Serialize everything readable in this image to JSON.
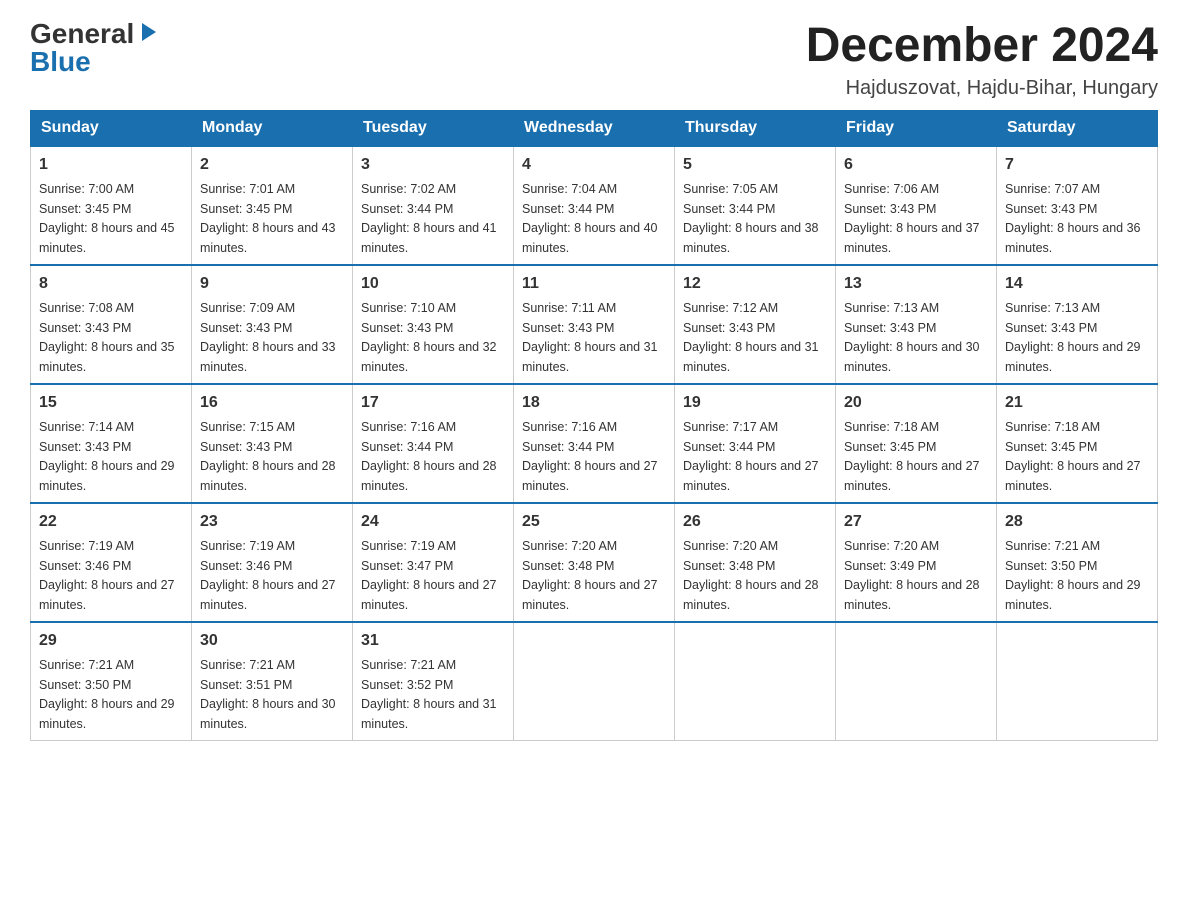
{
  "header": {
    "logo_general": "General",
    "logo_blue": "Blue",
    "month_title": "December 2024",
    "location": "Hajduszovat, Hajdu-Bihar, Hungary"
  },
  "columns": [
    "Sunday",
    "Monday",
    "Tuesday",
    "Wednesday",
    "Thursday",
    "Friday",
    "Saturday"
  ],
  "weeks": [
    [
      {
        "day": "1",
        "sunrise": "Sunrise: 7:00 AM",
        "sunset": "Sunset: 3:45 PM",
        "daylight": "Daylight: 8 hours and 45 minutes."
      },
      {
        "day": "2",
        "sunrise": "Sunrise: 7:01 AM",
        "sunset": "Sunset: 3:45 PM",
        "daylight": "Daylight: 8 hours and 43 minutes."
      },
      {
        "day": "3",
        "sunrise": "Sunrise: 7:02 AM",
        "sunset": "Sunset: 3:44 PM",
        "daylight": "Daylight: 8 hours and 41 minutes."
      },
      {
        "day": "4",
        "sunrise": "Sunrise: 7:04 AM",
        "sunset": "Sunset: 3:44 PM",
        "daylight": "Daylight: 8 hours and 40 minutes."
      },
      {
        "day": "5",
        "sunrise": "Sunrise: 7:05 AM",
        "sunset": "Sunset: 3:44 PM",
        "daylight": "Daylight: 8 hours and 38 minutes."
      },
      {
        "day": "6",
        "sunrise": "Sunrise: 7:06 AM",
        "sunset": "Sunset: 3:43 PM",
        "daylight": "Daylight: 8 hours and 37 minutes."
      },
      {
        "day": "7",
        "sunrise": "Sunrise: 7:07 AM",
        "sunset": "Sunset: 3:43 PM",
        "daylight": "Daylight: 8 hours and 36 minutes."
      }
    ],
    [
      {
        "day": "8",
        "sunrise": "Sunrise: 7:08 AM",
        "sunset": "Sunset: 3:43 PM",
        "daylight": "Daylight: 8 hours and 35 minutes."
      },
      {
        "day": "9",
        "sunrise": "Sunrise: 7:09 AM",
        "sunset": "Sunset: 3:43 PM",
        "daylight": "Daylight: 8 hours and 33 minutes."
      },
      {
        "day": "10",
        "sunrise": "Sunrise: 7:10 AM",
        "sunset": "Sunset: 3:43 PM",
        "daylight": "Daylight: 8 hours and 32 minutes."
      },
      {
        "day": "11",
        "sunrise": "Sunrise: 7:11 AM",
        "sunset": "Sunset: 3:43 PM",
        "daylight": "Daylight: 8 hours and 31 minutes."
      },
      {
        "day": "12",
        "sunrise": "Sunrise: 7:12 AM",
        "sunset": "Sunset: 3:43 PM",
        "daylight": "Daylight: 8 hours and 31 minutes."
      },
      {
        "day": "13",
        "sunrise": "Sunrise: 7:13 AM",
        "sunset": "Sunset: 3:43 PM",
        "daylight": "Daylight: 8 hours and 30 minutes."
      },
      {
        "day": "14",
        "sunrise": "Sunrise: 7:13 AM",
        "sunset": "Sunset: 3:43 PM",
        "daylight": "Daylight: 8 hours and 29 minutes."
      }
    ],
    [
      {
        "day": "15",
        "sunrise": "Sunrise: 7:14 AM",
        "sunset": "Sunset: 3:43 PM",
        "daylight": "Daylight: 8 hours and 29 minutes."
      },
      {
        "day": "16",
        "sunrise": "Sunrise: 7:15 AM",
        "sunset": "Sunset: 3:43 PM",
        "daylight": "Daylight: 8 hours and 28 minutes."
      },
      {
        "day": "17",
        "sunrise": "Sunrise: 7:16 AM",
        "sunset": "Sunset: 3:44 PM",
        "daylight": "Daylight: 8 hours and 28 minutes."
      },
      {
        "day": "18",
        "sunrise": "Sunrise: 7:16 AM",
        "sunset": "Sunset: 3:44 PM",
        "daylight": "Daylight: 8 hours and 27 minutes."
      },
      {
        "day": "19",
        "sunrise": "Sunrise: 7:17 AM",
        "sunset": "Sunset: 3:44 PM",
        "daylight": "Daylight: 8 hours and 27 minutes."
      },
      {
        "day": "20",
        "sunrise": "Sunrise: 7:18 AM",
        "sunset": "Sunset: 3:45 PM",
        "daylight": "Daylight: 8 hours and 27 minutes."
      },
      {
        "day": "21",
        "sunrise": "Sunrise: 7:18 AM",
        "sunset": "Sunset: 3:45 PM",
        "daylight": "Daylight: 8 hours and 27 minutes."
      }
    ],
    [
      {
        "day": "22",
        "sunrise": "Sunrise: 7:19 AM",
        "sunset": "Sunset: 3:46 PM",
        "daylight": "Daylight: 8 hours and 27 minutes."
      },
      {
        "day": "23",
        "sunrise": "Sunrise: 7:19 AM",
        "sunset": "Sunset: 3:46 PM",
        "daylight": "Daylight: 8 hours and 27 minutes."
      },
      {
        "day": "24",
        "sunrise": "Sunrise: 7:19 AM",
        "sunset": "Sunset: 3:47 PM",
        "daylight": "Daylight: 8 hours and 27 minutes."
      },
      {
        "day": "25",
        "sunrise": "Sunrise: 7:20 AM",
        "sunset": "Sunset: 3:48 PM",
        "daylight": "Daylight: 8 hours and 27 minutes."
      },
      {
        "day": "26",
        "sunrise": "Sunrise: 7:20 AM",
        "sunset": "Sunset: 3:48 PM",
        "daylight": "Daylight: 8 hours and 28 minutes."
      },
      {
        "day": "27",
        "sunrise": "Sunrise: 7:20 AM",
        "sunset": "Sunset: 3:49 PM",
        "daylight": "Daylight: 8 hours and 28 minutes."
      },
      {
        "day": "28",
        "sunrise": "Sunrise: 7:21 AM",
        "sunset": "Sunset: 3:50 PM",
        "daylight": "Daylight: 8 hours and 29 minutes."
      }
    ],
    [
      {
        "day": "29",
        "sunrise": "Sunrise: 7:21 AM",
        "sunset": "Sunset: 3:50 PM",
        "daylight": "Daylight: 8 hours and 29 minutes."
      },
      {
        "day": "30",
        "sunrise": "Sunrise: 7:21 AM",
        "sunset": "Sunset: 3:51 PM",
        "daylight": "Daylight: 8 hours and 30 minutes."
      },
      {
        "day": "31",
        "sunrise": "Sunrise: 7:21 AM",
        "sunset": "Sunset: 3:52 PM",
        "daylight": "Daylight: 8 hours and 31 minutes."
      },
      null,
      null,
      null,
      null
    ]
  ]
}
